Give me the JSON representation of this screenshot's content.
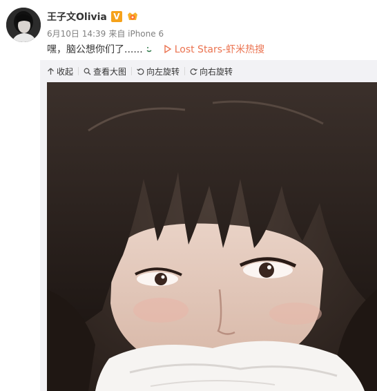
{
  "post": {
    "author": "王子文Olivia",
    "verified_badge": "V",
    "date": "6月10日 14:39",
    "source": "来自 iPhone 6",
    "text": "嘿，脑公想你们了......",
    "music_link": "Lost Stars-虾米热搜"
  },
  "toolbar": {
    "collapse": "收起",
    "view_large": "查看大图",
    "rotate_left": "向左旋转",
    "rotate_right": "向右旋转"
  },
  "icons": [
    "avatar",
    "verified-icon",
    "vip-icon",
    "emoji-icon",
    "play-icon",
    "collapse-icon",
    "magnifier-icon",
    "rotate-left-icon",
    "rotate-right-icon"
  ],
  "colors": {
    "link": "#eb7350",
    "badge": "#f5a21b",
    "muted": "#808080",
    "media_bg": "#f2f2f5"
  }
}
